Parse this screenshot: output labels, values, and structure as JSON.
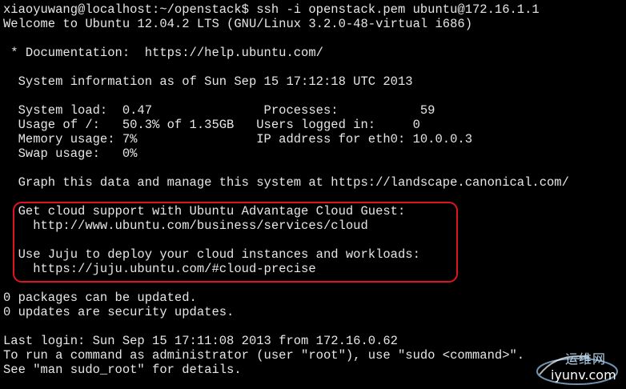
{
  "terminal": {
    "lines": [
      "xiaoyuwang@localhost:~/openstack$ ssh -i openstack.pem ubuntu@172.16.1.1",
      "Welcome to Ubuntu 12.04.2 LTS (GNU/Linux 3.2.0-48-virtual i686)",
      "",
      " * Documentation:  https://help.ubuntu.com/",
      "",
      "  System information as of Sun Sep 15 17:12:18 UTC 2013",
      "",
      "  System load:  0.47               Processes:           59",
      "  Usage of /:   50.3% of 1.35GB   Users logged in:     0",
      "  Memory usage: 7%                IP address for eth0: 10.0.0.3",
      "  Swap usage:   0%",
      "",
      "  Graph this data and manage this system at https://landscape.canonical.com/",
      "",
      "  Get cloud support with Ubuntu Advantage Cloud Guest:",
      "    http://www.ubuntu.com/business/services/cloud",
      "",
      "  Use Juju to deploy your cloud instances and workloads:",
      "    https://juju.ubuntu.com/#cloud-precise",
      "",
      "0 packages can be updated.",
      "0 updates are security updates.",
      "",
      "Last login: Sun Sep 15 17:11:08 2013 from 172.16.0.62",
      "To run a command as administrator (user \"root\"), use \"sudo <command>\".",
      "See \"man sudo_root\" for details."
    ]
  },
  "colors": {
    "background": "#000000",
    "text": "#e6e6e6",
    "highlight_border": "#e0141e"
  },
  "watermark": {
    "title": "运维网",
    "domain": "iyunv.com"
  }
}
